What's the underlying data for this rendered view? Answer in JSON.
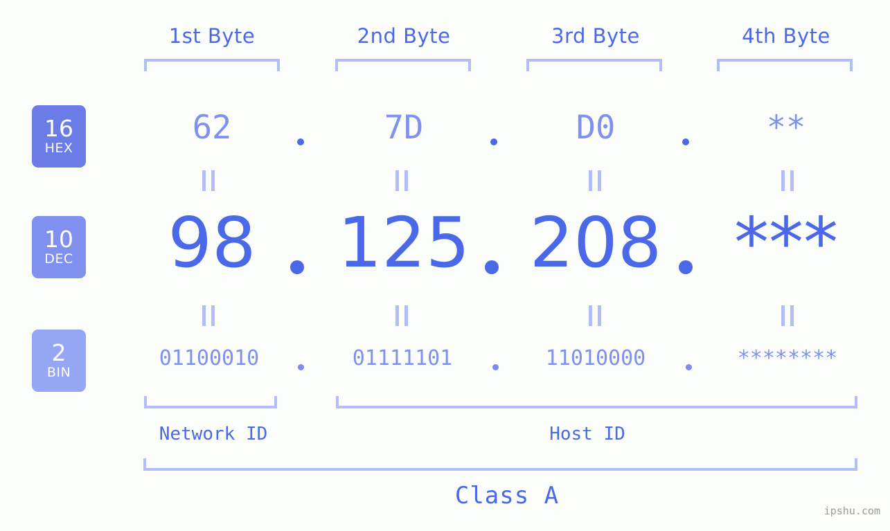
{
  "meta": {
    "background_color": "#fbfdfa",
    "accent_strong": "#4a68e8",
    "accent_medium": "#8090ee",
    "accent_light": "#b4bdf7",
    "watermark": "ipshu.com"
  },
  "headers": [
    {
      "label": "1st Byte"
    },
    {
      "label": "2nd Byte"
    },
    {
      "label": "3rd Byte"
    },
    {
      "label": "4th Byte"
    }
  ],
  "bases": [
    {
      "num": "16",
      "abbr": "HEX",
      "color": "#6b7ce8"
    },
    {
      "num": "10",
      "abbr": "DEC",
      "color": "#8090ee"
    },
    {
      "num": "2",
      "abbr": "BIN",
      "color": "#94a6f4"
    }
  ],
  "rows": {
    "hex": {
      "values": [
        "62",
        "7D",
        "D0",
        "**"
      ],
      "separator": "."
    },
    "dec": {
      "values": [
        "98",
        "125",
        "208",
        "***"
      ],
      "separator": "."
    },
    "bin": {
      "values": [
        "01100010",
        "01111101",
        "11010000",
        "********"
      ],
      "separator": "."
    }
  },
  "equality_symbol": "=",
  "segments": {
    "network": {
      "label": "Network ID"
    },
    "host": {
      "label": "Host ID"
    }
  },
  "class": {
    "label": "Class A"
  }
}
